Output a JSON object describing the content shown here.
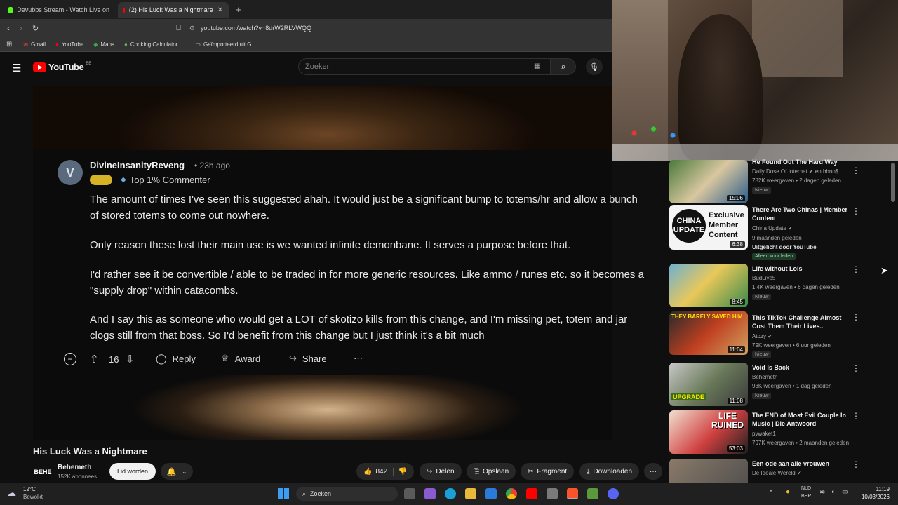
{
  "browser": {
    "tabs": [
      {
        "label": "Devubbs Stream - Watch Live on"
      },
      {
        "label": "(2) His Luck Was a Nightmare"
      }
    ],
    "url": "youtube.com/watch?v=8drW2RLVWQQ",
    "bookmarks": [
      "Gmail",
      "YouTube",
      "Maps",
      "Cooking Calculator |...",
      "Geïmporteerd uit G..."
    ]
  },
  "youtube": {
    "logo": "YouTube",
    "region": "BE",
    "search_placeholder": "Zoeken"
  },
  "comment": {
    "author": "DivineInsanityReveng",
    "time": "• 23h ago",
    "flair": "Top 1% Commenter",
    "paragraphs": [
      "The amount of times I've seen this suggested ahah. It would just be a significant bump to totems/hr and allow a bunch of stored totems to come out nowhere.",
      "Only reason these lost their main use is we wanted infinite demonbane. It serves a purpose before that.",
      "I'd rather see it be convertible / able to be traded in for more generic resources. Like ammo / runes etc. so it becomes a \"supply drop\" within catacombs.",
      "And I say this as someone who would get a LOT of skotizo kills from this change, and I'm missing pet, totem and jar clogs still from that boss. So I'd benefit from this change but I just think it's a bit much"
    ],
    "votes": "16",
    "reply": "Reply",
    "award": "Award",
    "share": "Share",
    "more": "···"
  },
  "video": {
    "title": "His Luck Was a Nightmare",
    "channel": "Behemeth",
    "subscribers": "152K abonnees",
    "join": "Lid worden",
    "likes": "842",
    "share": "Delen",
    "save": "Opslaan",
    "clip": "Fragment",
    "download": "Downloaden",
    "more": "···"
  },
  "recommendations": [
    {
      "title": "He Found Out The Hard Way",
      "channel": "Daily Dose Of Internet ✔ en bbno$",
      "meta": "782K weergaven • 2 dagen geleden",
      "badge": "Nieuw",
      "duration": "15:06"
    },
    {
      "title": "There Are Two Chinas | Member Content",
      "channel": "China Update ✔",
      "meta": "9 maanden geleden",
      "extra": "Uitgelicht door YouTube",
      "badge": "Alleen voor leden",
      "duration": "6:38",
      "thumb_text": "CHINA UPDATE"
    },
    {
      "title": "Life without Lois",
      "channel": "BudLive5",
      "meta": "1,4K weergaven • 6 dagen geleden",
      "badge": "Nieuw",
      "duration": "8:45"
    },
    {
      "title": "This TikTok Challenge Almost Cost Them Their Lives..",
      "channel": "Atozy ✔",
      "meta": "79K weergaven • 6 uur geleden",
      "badge": "Nieuw",
      "duration": "11:04",
      "thumb_text": "THEY BARELY SAVED HIM"
    },
    {
      "title": "Void Is Back",
      "channel": "Behemeth",
      "meta": "93K weergaven • 1 dag geleden",
      "badge": "Nieuw",
      "duration": "11:08",
      "thumb_text": "UPGRADE"
    },
    {
      "title": "The END of Most Evil Couple In Music | Die Antwoord",
      "channel": "pywaket1",
      "meta": "797K weergaven • 2 maanden geleden",
      "duration": "53:03",
      "thumb_text": "LIFE RUINED"
    },
    {
      "title": "Een ode aan alle vrouwen",
      "channel": "De Ideale Wereld ✔",
      "meta": "",
      "duration": ""
    }
  ],
  "taskbar": {
    "weather_temp": "12°C",
    "weather_desc": "Bewolkt",
    "search": "Zoeken",
    "lang1": "NLD",
    "lang2": "BEP",
    "time": "11:19",
    "date": "10/03/2026"
  }
}
